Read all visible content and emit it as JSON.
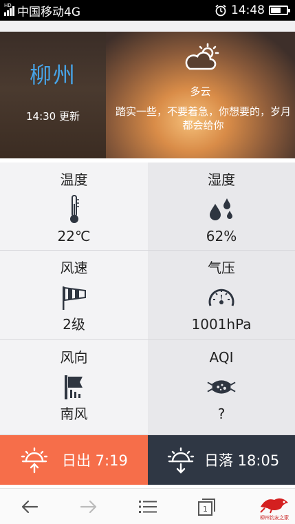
{
  "status_bar": {
    "network_badge": "HD",
    "carrier": "中国移动4G",
    "time": "14:48",
    "battery_level": 0.6
  },
  "hero": {
    "city": "柳州",
    "update_time": "14:30 更新",
    "weather_icon": "partly-cloudy-icon",
    "weather_desc": "多云",
    "quote": "踏实一些，不要着急，你想要的，岁月都会给你"
  },
  "metrics": [
    {
      "label": "温度",
      "icon": "thermometer-icon",
      "value": "22℃"
    },
    {
      "label": "湿度",
      "icon": "water-drops-icon",
      "value": "62%"
    },
    {
      "label": "风速",
      "icon": "windsock-icon",
      "value": "2级"
    },
    {
      "label": "气压",
      "icon": "pressure-gauge-icon",
      "value": "1001hPa"
    },
    {
      "label": "风向",
      "icon": "wind-flag-icon",
      "value": "南风"
    },
    {
      "label": "AQI",
      "icon": "mask-icon",
      "value": "?"
    }
  ],
  "sun": {
    "sunrise": "日出 7:19",
    "sunset": "日落 18:05"
  },
  "nav": {
    "tab_count": "1",
    "logo_text": "柳州钓友之家"
  },
  "colors": {
    "city": "#47a3e6",
    "sunrise_bg": "#f66e4a",
    "sunset_bg": "#2f3744"
  }
}
